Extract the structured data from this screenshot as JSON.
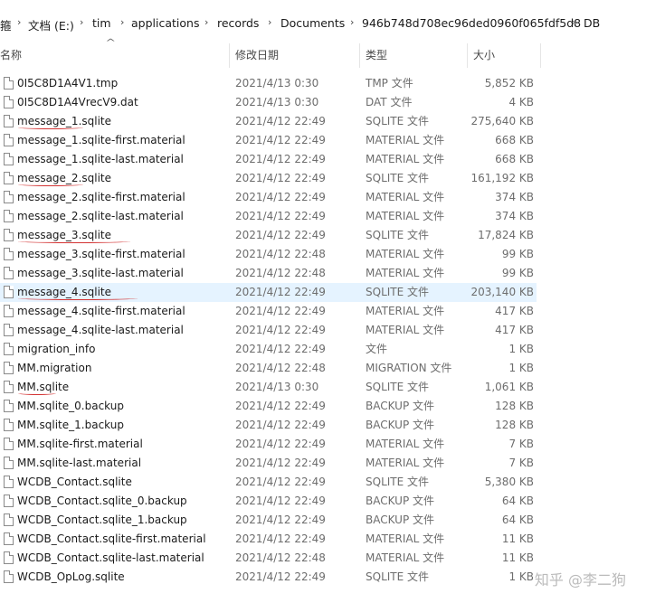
{
  "breadcrumb": [
    {
      "label": "箍"
    },
    {
      "label": "文档 (E:)"
    },
    {
      "label": "tim"
    },
    {
      "label": "applications"
    },
    {
      "label": "records"
    },
    {
      "label": "Documents"
    },
    {
      "label": "946b748d708ec96ded0960f065fdf5d8"
    },
    {
      "label": "DB"
    }
  ],
  "columns": {
    "name": "名称",
    "date": "修改日期",
    "type": "类型",
    "size": "大小"
  },
  "rows": [
    {
      "name": "0I5C8D1A4V1.tmp",
      "date": "2021/4/13 0:30",
      "type": "TMP 文件",
      "size": "5,852 KB"
    },
    {
      "name": "0I5C8D1A4VrecV9.dat",
      "date": "2021/4/13 0:30",
      "type": "DAT 文件",
      "size": "4 KB"
    },
    {
      "name": "message_1.sqlite",
      "date": "2021/4/12 22:49",
      "type": "SQLITE 文件",
      "size": "275,640 KB"
    },
    {
      "name": "message_1.sqlite-first.material",
      "date": "2021/4/12 22:49",
      "type": "MATERIAL 文件",
      "size": "668 KB"
    },
    {
      "name": "message_1.sqlite-last.material",
      "date": "2021/4/12 22:49",
      "type": "MATERIAL 文件",
      "size": "668 KB"
    },
    {
      "name": "message_2.sqlite",
      "date": "2021/4/12 22:49",
      "type": "SQLITE 文件",
      "size": "161,192 KB"
    },
    {
      "name": "message_2.sqlite-first.material",
      "date": "2021/4/12 22:49",
      "type": "MATERIAL 文件",
      "size": "374 KB"
    },
    {
      "name": "message_2.sqlite-last.material",
      "date": "2021/4/12 22:49",
      "type": "MATERIAL 文件",
      "size": "374 KB"
    },
    {
      "name": "message_3.sqlite",
      "date": "2021/4/12 22:49",
      "type": "SQLITE 文件",
      "size": "17,824 KB"
    },
    {
      "name": "message_3.sqlite-first.material",
      "date": "2021/4/12 22:48",
      "type": "MATERIAL 文件",
      "size": "99 KB"
    },
    {
      "name": "message_3.sqlite-last.material",
      "date": "2021/4/12 22:48",
      "type": "MATERIAL 文件",
      "size": "99 KB"
    },
    {
      "name": "message_4.sqlite",
      "date": "2021/4/12 22:49",
      "type": "SQLITE 文件",
      "size": "203,140 KB"
    },
    {
      "name": "message_4.sqlite-first.material",
      "date": "2021/4/12 22:49",
      "type": "MATERIAL 文件",
      "size": "417 KB"
    },
    {
      "name": "message_4.sqlite-last.material",
      "date": "2021/4/12 22:49",
      "type": "MATERIAL 文件",
      "size": "417 KB"
    },
    {
      "name": "migration_info",
      "date": "2021/4/12 22:49",
      "type": "文件",
      "size": "1 KB"
    },
    {
      "name": "MM.migration",
      "date": "2021/4/12 22:48",
      "type": "MIGRATION 文件",
      "size": "1 KB"
    },
    {
      "name": "MM.sqlite",
      "date": "2021/4/13 0:30",
      "type": "SQLITE 文件",
      "size": "1,061 KB"
    },
    {
      "name": "MM.sqlite_0.backup",
      "date": "2021/4/12 22:49",
      "type": "BACKUP 文件",
      "size": "128 KB"
    },
    {
      "name": "MM.sqlite_1.backup",
      "date": "2021/4/12 22:49",
      "type": "BACKUP 文件",
      "size": "128 KB"
    },
    {
      "name": "MM.sqlite-first.material",
      "date": "2021/4/12 22:49",
      "type": "MATERIAL 文件",
      "size": "7 KB"
    },
    {
      "name": "MM.sqlite-last.material",
      "date": "2021/4/12 22:49",
      "type": "MATERIAL 文件",
      "size": "7 KB"
    },
    {
      "name": "WCDB_Contact.sqlite",
      "date": "2021/4/12 22:49",
      "type": "SQLITE 文件",
      "size": "5,380 KB"
    },
    {
      "name": "WCDB_Contact.sqlite_0.backup",
      "date": "2021/4/12 22:49",
      "type": "BACKUP 文件",
      "size": "64 KB"
    },
    {
      "name": "WCDB_Contact.sqlite_1.backup",
      "date": "2021/4/12 22:49",
      "type": "BACKUP 文件",
      "size": "64 KB"
    },
    {
      "name": "WCDB_Contact.sqlite-first.material",
      "date": "2021/4/12 22:49",
      "type": "MATERIAL 文件",
      "size": "11 KB"
    },
    {
      "name": "WCDB_Contact.sqlite-last.material",
      "date": "2021/4/12 22:48",
      "type": "MATERIAL 文件",
      "size": "11 KB"
    },
    {
      "name": "WCDB_OpLog.sqlite",
      "date": "2021/4/12 22:49",
      "type": "SQLITE 文件",
      "size": "1 KB"
    }
  ],
  "selected_row": "message_4.sqlite",
  "watermark": "知乎 @李二狗",
  "colors": {
    "selected_bg": "#e5f3ff",
    "annotation_underline": "#d33333"
  }
}
